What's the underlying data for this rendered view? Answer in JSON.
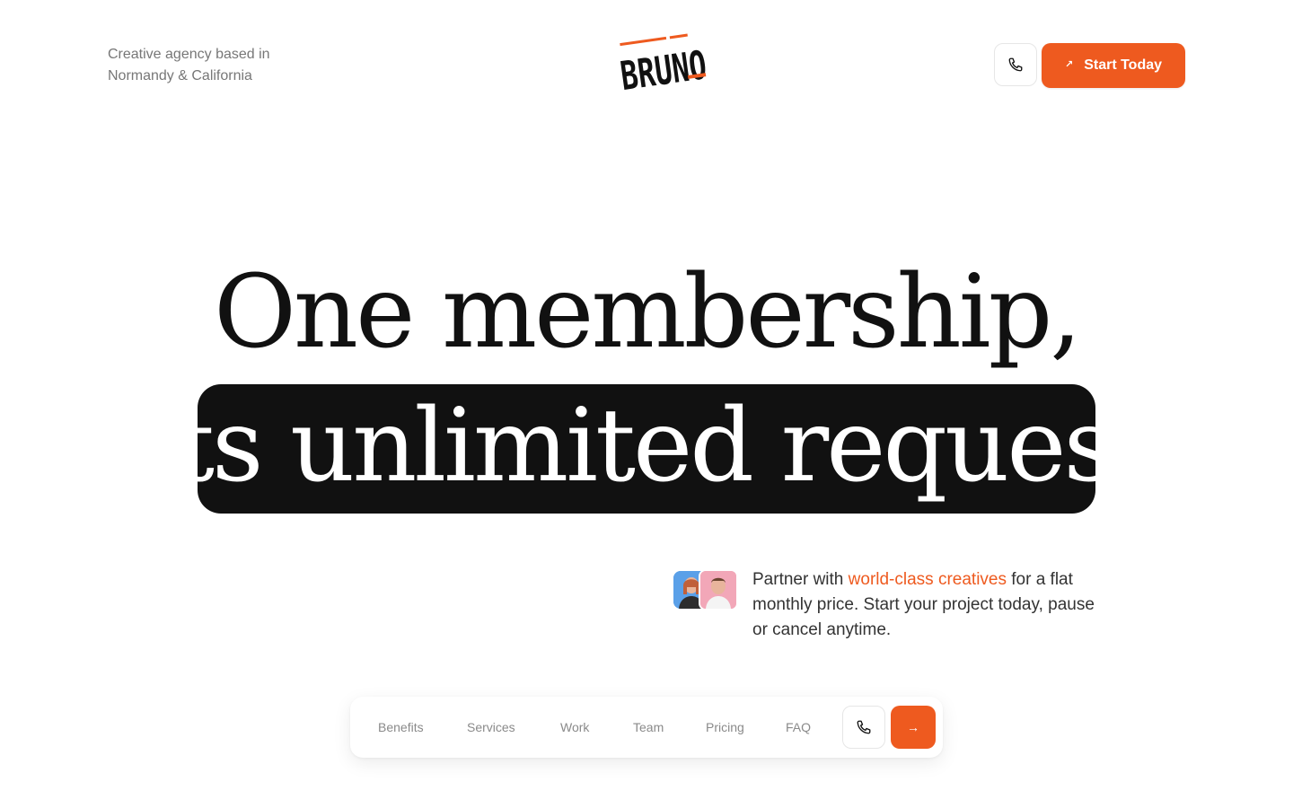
{
  "header": {
    "tagline_line1": "Creative agency based in",
    "tagline_line2": "Normandy & California",
    "logo_text": "BRUNO",
    "cta_label": "Start Today",
    "cta_icon": "arrow-up-right-icon",
    "phone_icon": "phone-icon"
  },
  "hero": {
    "line1": "One membership,",
    "line2": "ts  unlimited reques"
  },
  "blurb": {
    "text_before": "Partner with ",
    "highlight": "world-class creatives",
    "text_after": " for a flat monthly price. Start your project today, pause or cancel anytime."
  },
  "nav": {
    "items": [
      "Benefits",
      "Services",
      "Work",
      "Team",
      "Pricing",
      "FAQ"
    ],
    "phone_icon": "phone-icon",
    "go_icon": "arrow-right-icon"
  },
  "colors": {
    "accent": "#ee5a1f",
    "dark": "#111111",
    "muted": "#777777"
  }
}
